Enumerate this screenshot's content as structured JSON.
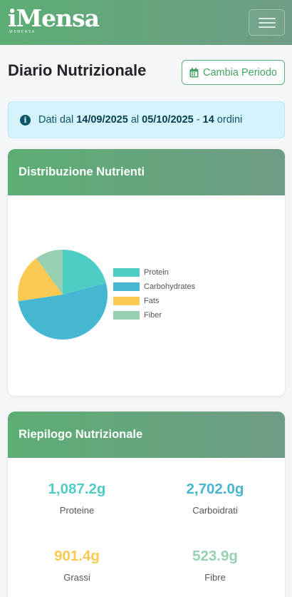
{
  "navbar": {
    "logo_text": "iMensa",
    "logo_sub": "WEMENSA",
    "menu_icon": "hamburger-menu-icon"
  },
  "page": {
    "title": "Diario Nutrizionale",
    "period_button": "Cambia Periodo",
    "period_icon": "calendar-icon"
  },
  "info": {
    "prefix": "Dati dal",
    "from": "14/09/2025",
    "middle": "al",
    "to": "05/10/2025",
    "dash": "-",
    "orders_count": "14",
    "orders_label": "ordini",
    "icon": "info-circle-icon"
  },
  "distribution": {
    "header": "Distribuzione Nutrienti"
  },
  "chart_data": {
    "type": "pie",
    "labels": [
      "Protein",
      "Carbohydrates",
      "Fats",
      "Fiber"
    ],
    "values": [
      1087.2,
      2702.0,
      901.4,
      523.9
    ],
    "colors": [
      "#4ecdc4",
      "#45b7d1",
      "#fcc952",
      "#96d0b0"
    ],
    "legend_position": "right"
  },
  "summary": {
    "header": "Riepilogo Nutrizionale",
    "items": [
      {
        "value": "1,087.2g",
        "label": "Proteine",
        "color": "#4ecdc4"
      },
      {
        "value": "2,702.0g",
        "label": "Carboidrati",
        "color": "#45b7d1"
      },
      {
        "value": "901.4g",
        "label": "Grassi",
        "color": "#fcc952"
      },
      {
        "value": "523.9g",
        "label": "Fibre",
        "color": "#96d0b0"
      }
    ]
  }
}
